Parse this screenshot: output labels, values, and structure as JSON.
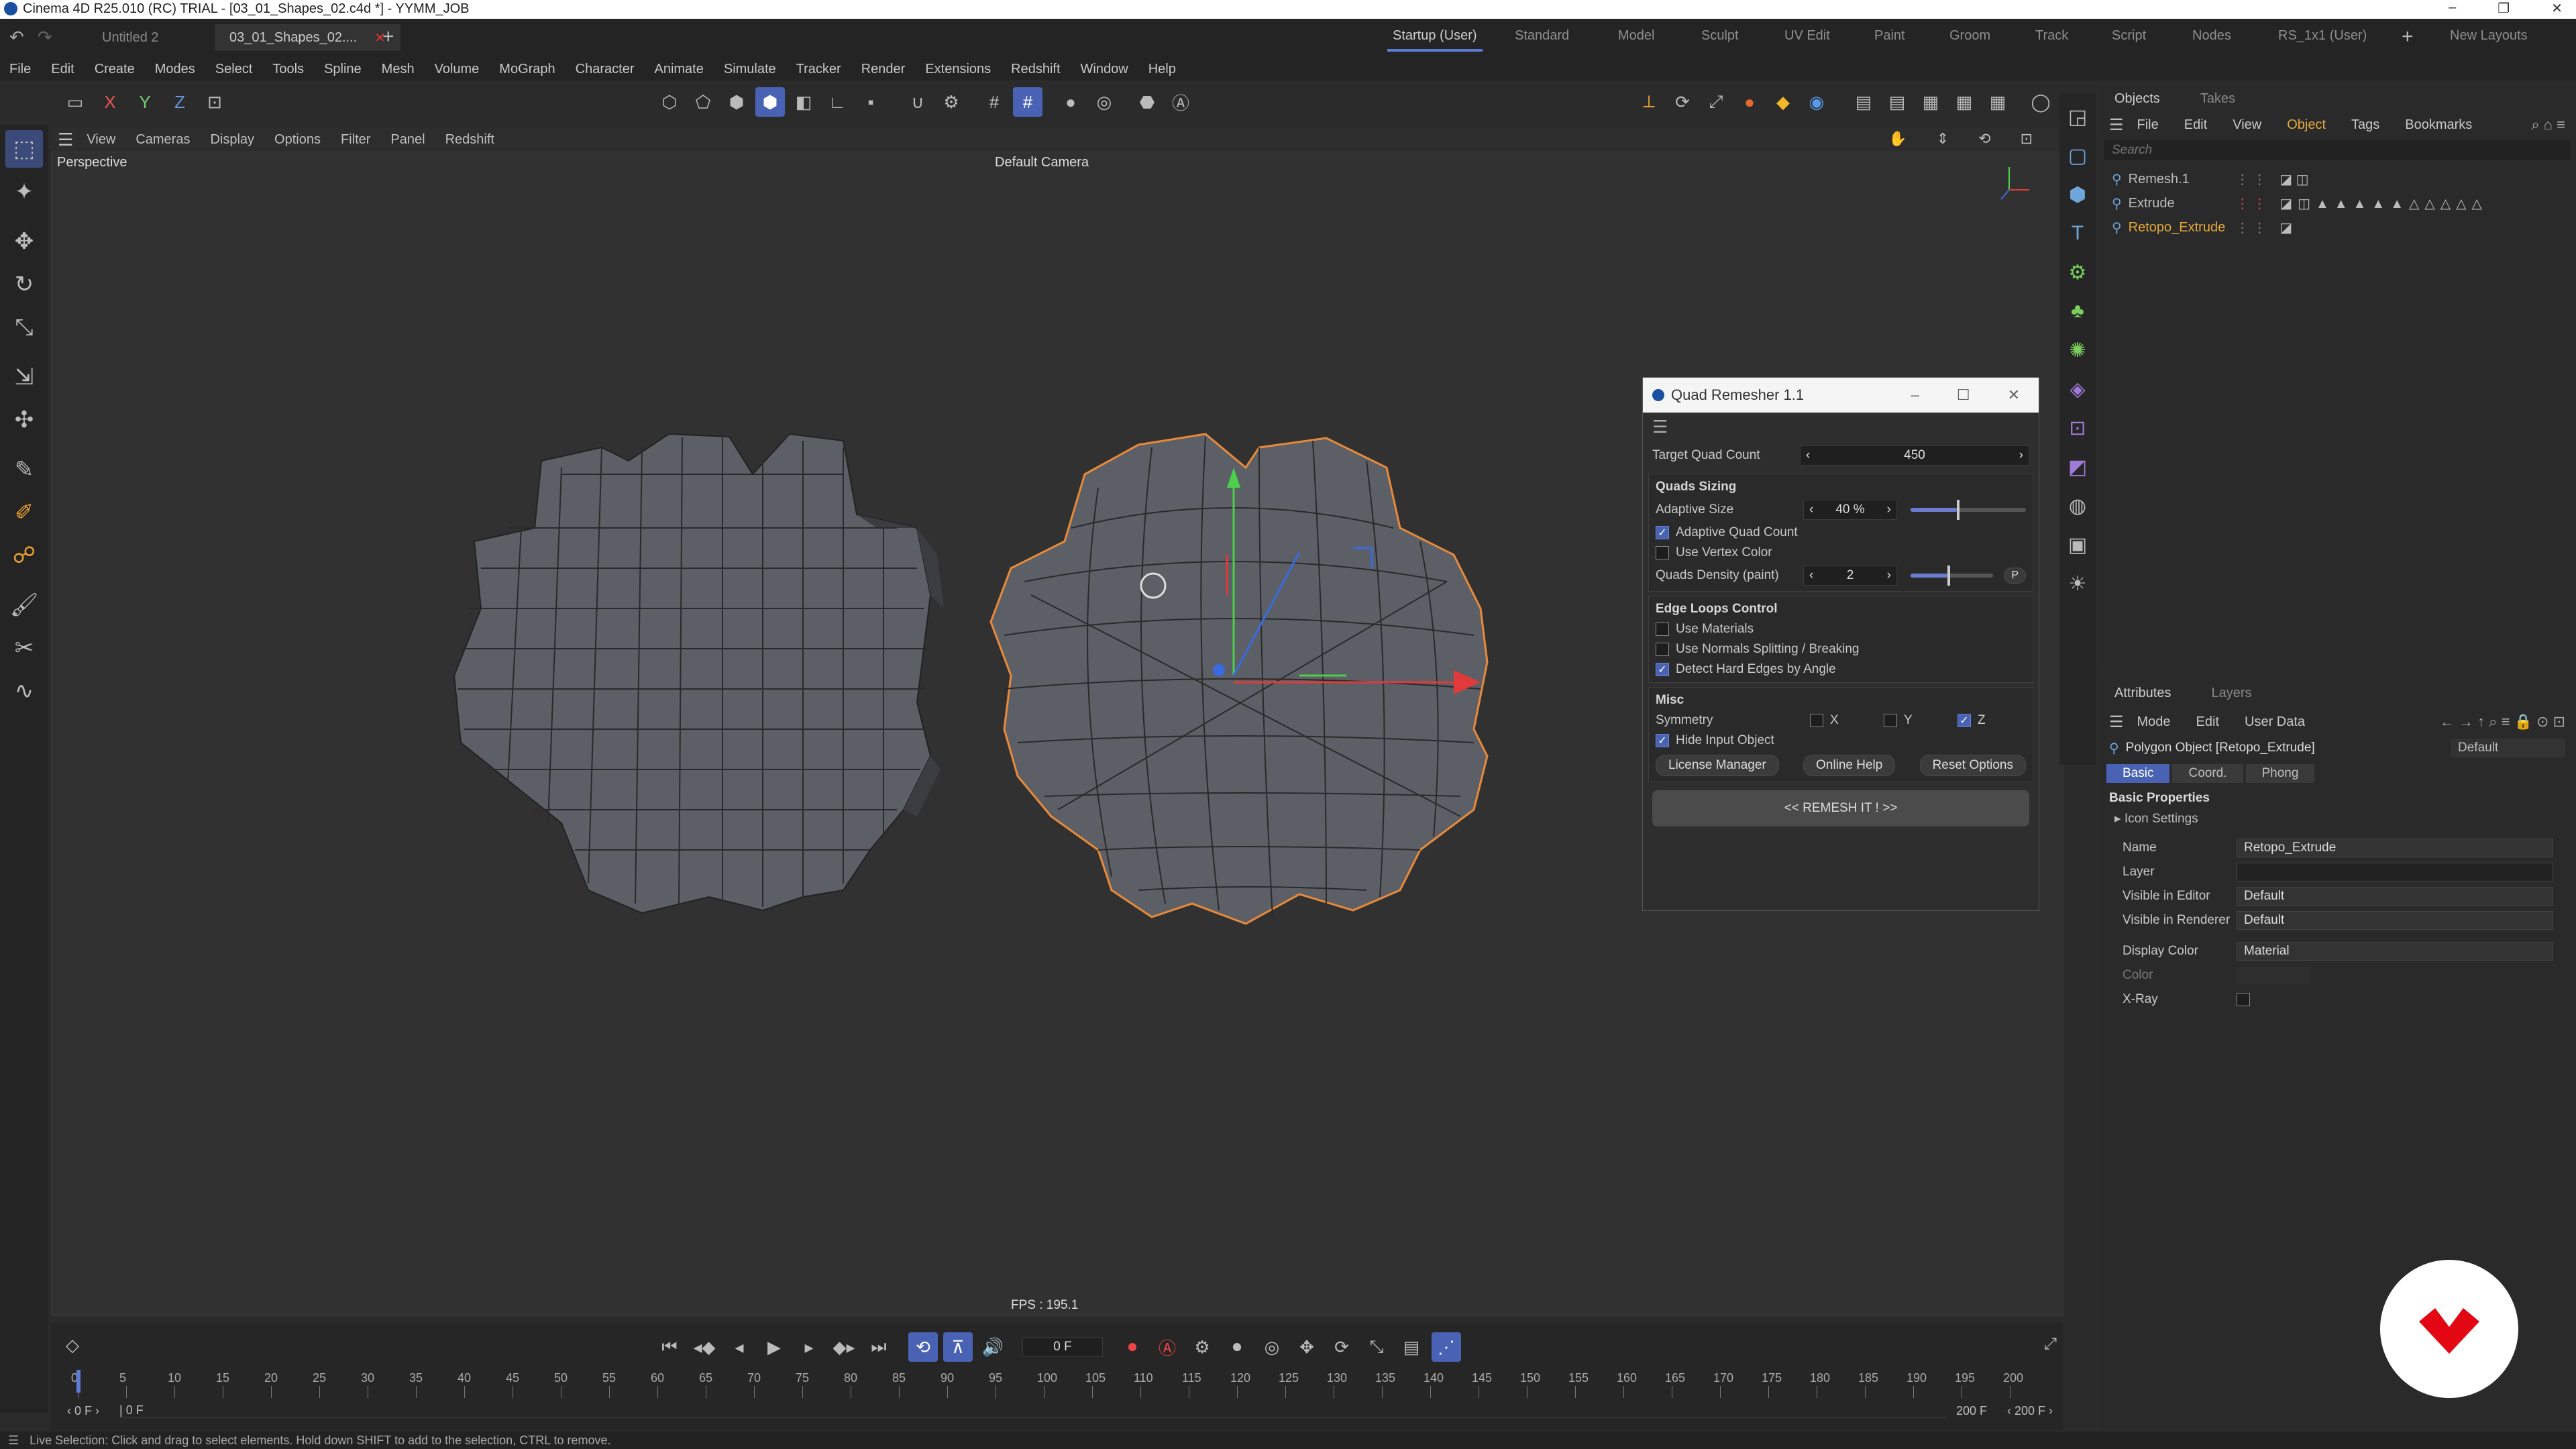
{
  "window": {
    "title": "Cinema 4D R25.010 (RC) TRIAL - [03_01_Shapes_02.c4d *] - YYMM_JOB"
  },
  "doc_tabs": [
    {
      "label": "Untitled 2"
    },
    {
      "label": "03_01_Shapes_02....",
      "active": true
    }
  ],
  "layouts": [
    "Startup (User)",
    "Standard",
    "Model",
    "Sculpt",
    "UV Edit",
    "Paint",
    "Groom",
    "Track",
    "Script",
    "Nodes",
    "RS_1x1 (User)"
  ],
  "new_layouts_label": "New Layouts",
  "menu": [
    "File",
    "Edit",
    "Create",
    "Modes",
    "Select",
    "Tools",
    "Spline",
    "Mesh",
    "Volume",
    "MoGraph",
    "Character",
    "Animate",
    "Simulate",
    "Tracker",
    "Render",
    "Extensions",
    "Redshift",
    "Window",
    "Help"
  ],
  "axis_labels": {
    "x": "X",
    "y": "Y",
    "z": "Z"
  },
  "viewport": {
    "menu": [
      "View",
      "Cameras",
      "Display",
      "Options",
      "Filter",
      "Panel",
      "Redshift"
    ],
    "projection": "Perspective",
    "camera": "Default Camera",
    "fps": "FPS : 195.1"
  },
  "quad_remesher": {
    "title": "Quad Remesher 1.1",
    "target_quad_count_label": "Target Quad Count",
    "target_quad_count": "450",
    "quads_sizing_label": "Quads Sizing",
    "adaptive_size_label": "Adaptive Size",
    "adaptive_size": "40 %",
    "adaptive_size_level": 0.4,
    "adaptive_quad_count_label": "Adaptive Quad Count",
    "use_vertex_color_label": "Use Vertex Color",
    "quads_density_label": "Quads Density (paint)",
    "quads_density": "2",
    "paint_btn": "P",
    "edge_loops_label": "Edge Loops Control",
    "use_materials_label": "Use Materials",
    "use_normals_label": "Use Normals Splitting / Breaking",
    "detect_hard_edges_label": "Detect Hard Edges by Angle",
    "misc_label": "Misc",
    "symmetry_label": "Symmetry",
    "sym_x": "X",
    "sym_y": "Y",
    "sym_z": "Z",
    "hide_input_label": "Hide Input Object",
    "license_btn": "License Manager",
    "help_btn": "Online Help",
    "reset_btn": "Reset Options",
    "remesh_btn": "<<   REMESH IT !   >>"
  },
  "objects_panel": {
    "tabs": [
      "Objects",
      "Takes"
    ],
    "menu": [
      "File",
      "Edit",
      "View",
      "Object",
      "Tags",
      "Bookmarks"
    ],
    "search_placeholder": "Search",
    "items": [
      {
        "name": "Remesh.1"
      },
      {
        "name": "Extrude"
      },
      {
        "name": "Retopo_Extrude",
        "selected": true
      }
    ]
  },
  "attributes_panel": {
    "tabs": [
      "Attributes",
      "Layers"
    ],
    "menu": [
      "Mode",
      "Edit",
      "User Data"
    ],
    "object_title": "Polygon Object [Retopo_Extrude]",
    "preset": "Default",
    "sub_tabs": [
      "Basic",
      "Coord.",
      "Phong"
    ],
    "section": "Basic Properties",
    "icon_settings": "Icon Settings",
    "name_label": "Name",
    "name_value": "Retopo_Extrude",
    "layer_label": "Layer",
    "vis_editor_label": "Visible in Editor",
    "vis_editor_value": "Default",
    "vis_render_label": "Visible in Renderer",
    "vis_render_value": "Default",
    "display_color_label": "Display Color",
    "display_color_value": "Material",
    "color_label": "Color",
    "xray_label": "X-Ray"
  },
  "timeline": {
    "ticks": [
      "0",
      "5",
      "10",
      "15",
      "20",
      "25",
      "30",
      "35",
      "40",
      "45",
      "50",
      "55",
      "60",
      "65",
      "70",
      "75",
      "80",
      "85",
      "90",
      "95",
      "100",
      "105",
      "110",
      "115",
      "120",
      "125",
      "130",
      "135",
      "140",
      "145",
      "150",
      "155",
      "160",
      "165",
      "170",
      "175",
      "180",
      "185",
      "190",
      "195",
      "200"
    ],
    "current_frame": "0 F",
    "start_frame": "0 F",
    "min_frame": "0 F",
    "end_frame": "200 F",
    "max_frame": "200 F"
  },
  "status": "Live Selection: Click and drag to select elements. Hold down SHIFT to add to the selection, CTRL to remove.",
  "colors": {
    "accent": "#4a62b4",
    "selected_obj": "#e5a93a",
    "brand": "#e30613"
  }
}
